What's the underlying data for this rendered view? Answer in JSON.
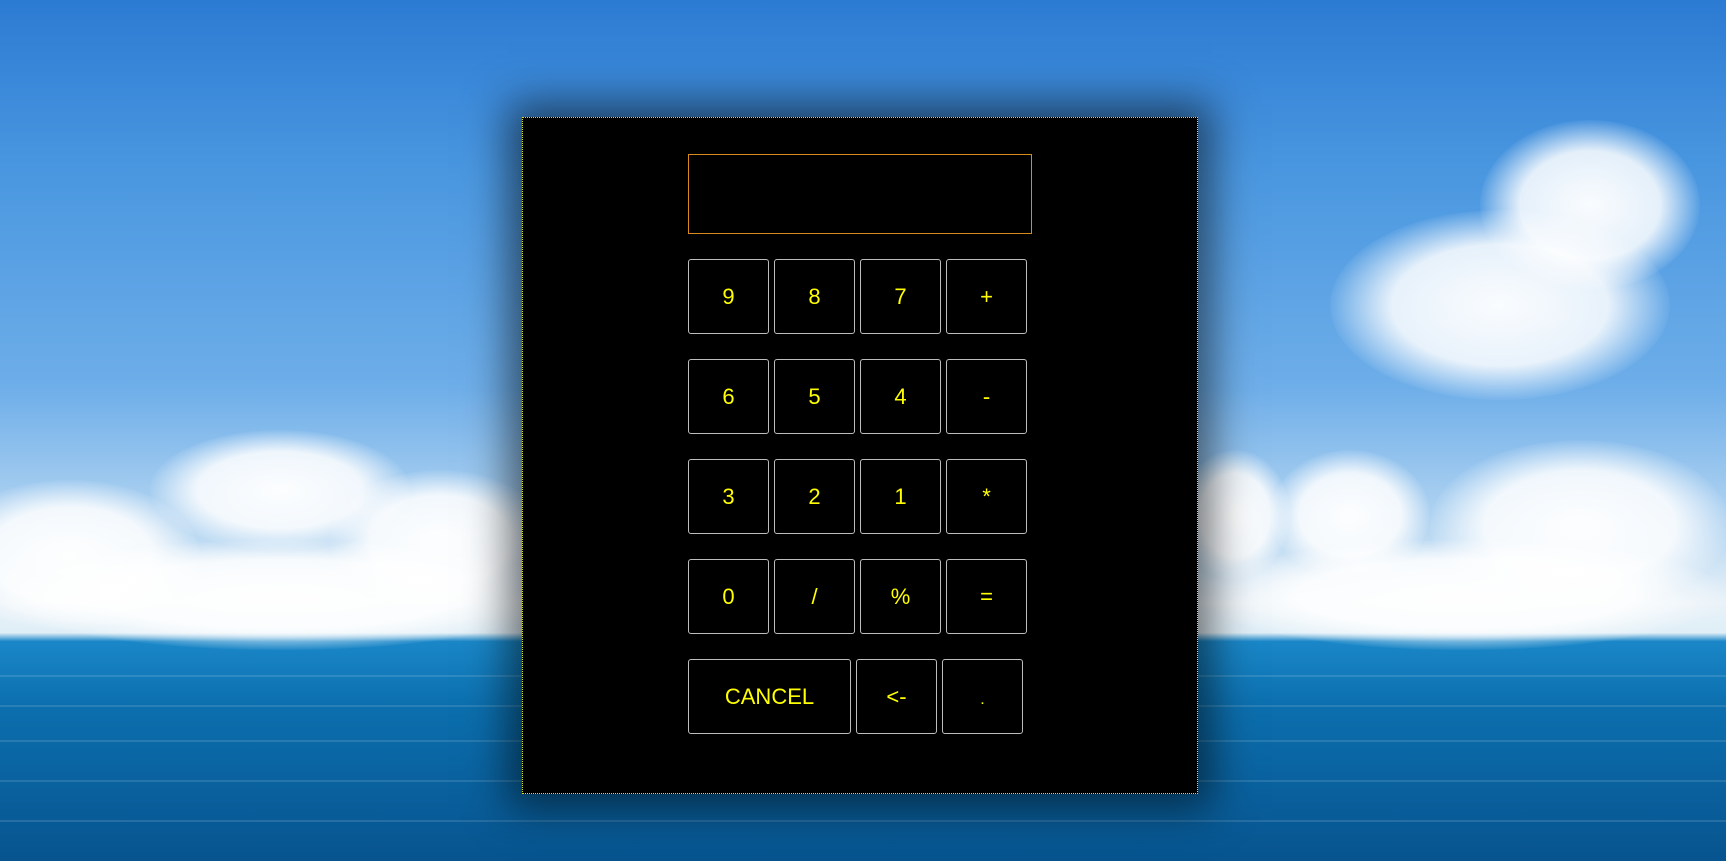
{
  "calculator": {
    "display_value": "",
    "rows": [
      [
        {
          "label": "9",
          "name": "key-9-button"
        },
        {
          "label": "8",
          "name": "key-8-button"
        },
        {
          "label": "7",
          "name": "key-7-button"
        },
        {
          "label": "+",
          "name": "plus-button"
        }
      ],
      [
        {
          "label": "6",
          "name": "key-6-button"
        },
        {
          "label": "5",
          "name": "key-5-button"
        },
        {
          "label": "4",
          "name": "key-4-button"
        },
        {
          "label": "-",
          "name": "minus-button"
        }
      ],
      [
        {
          "label": "3",
          "name": "key-3-button"
        },
        {
          "label": "2",
          "name": "key-2-button"
        },
        {
          "label": "1",
          "name": "key-1-button"
        },
        {
          "label": "*",
          "name": "multiply-button"
        }
      ],
      [
        {
          "label": "0",
          "name": "key-0-button"
        },
        {
          "label": "/",
          "name": "divide-button"
        },
        {
          "label": "%",
          "name": "percent-button"
        },
        {
          "label": "=",
          "name": "equals-button"
        }
      ]
    ],
    "bottom": {
      "cancel_label": "CANCEL",
      "backspace_label": "<-",
      "dot_label": "."
    }
  },
  "colors": {
    "key_text": "#ffff00",
    "panel_bg": "#000000",
    "display_border": "#d98a1c",
    "panel_border": "#d8e21c"
  }
}
